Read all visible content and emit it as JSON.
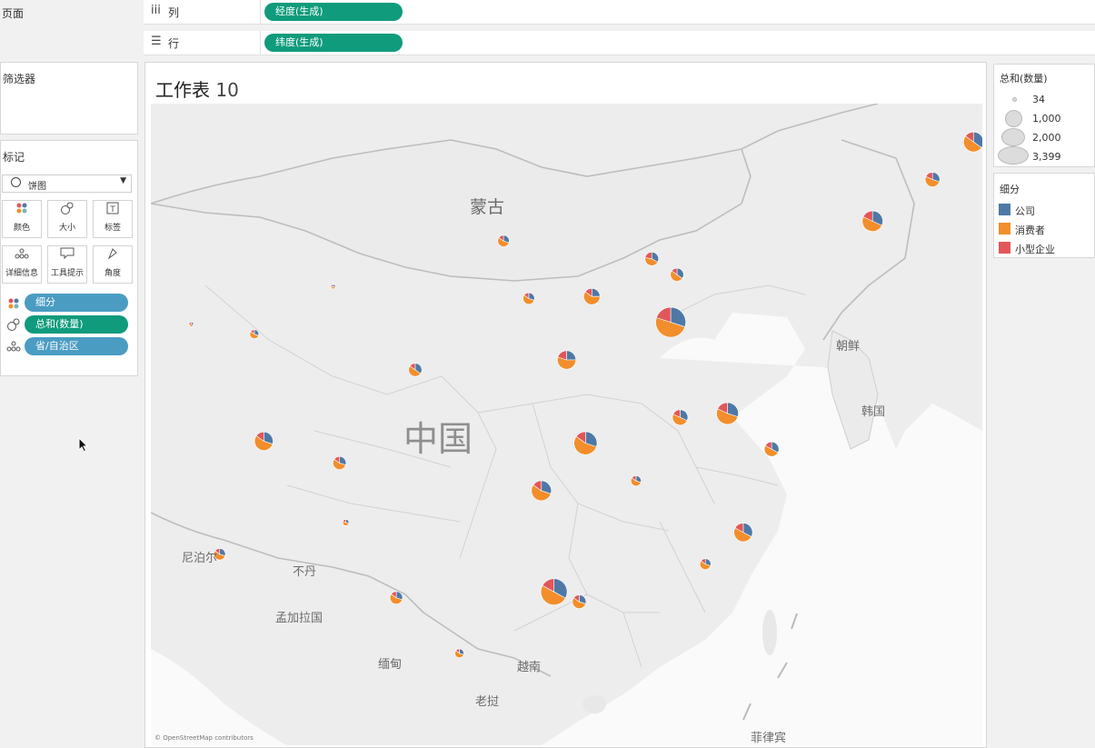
{
  "shelves": {
    "pages_title": "页面",
    "columns": {
      "icon": "iii",
      "label": "列",
      "pill": "经度(生成)"
    },
    "rows": {
      "icon": "☰",
      "label": "行",
      "pill": "纬度(生成)"
    }
  },
  "filters": {
    "title": "筛选器"
  },
  "marks": {
    "title": "标记",
    "type_value": "饼图",
    "buttons": [
      {
        "label": "颜色",
        "icon": "palette-icon"
      },
      {
        "label": "大小",
        "icon": "size-icon"
      },
      {
        "label": "标签",
        "icon": "text-icon"
      },
      {
        "label": "详细信息",
        "icon": "detail-icon"
      },
      {
        "label": "工具提示",
        "icon": "tooltip-icon"
      },
      {
        "label": "角度",
        "icon": "angle-icon"
      }
    ],
    "fields": [
      {
        "label": "细分",
        "color": "#4a9cc3",
        "icon": "color-dots-icon"
      },
      {
        "label": "总和(数量)",
        "color": "#0f9b7c",
        "icon": "size-icon"
      },
      {
        "label": "省/自治区",
        "color": "#4a9cc3",
        "icon": "detail-icon"
      }
    ]
  },
  "sheet": {
    "title": "工作表",
    "title_number": "10",
    "attribution": "© OpenStreetMap contributors",
    "map_labels": [
      "蒙古",
      "中国",
      "朝鲜",
      "韩国",
      "尼泊尔",
      "不丹",
      "孟加拉国",
      "缅甸",
      "越南",
      "老挝",
      "菲律宾"
    ]
  },
  "size_legend": {
    "title": "总和(数量)",
    "items": [
      "34",
      "1,000",
      "2,000",
      "3,399"
    ]
  },
  "color_legend": {
    "title": "细分",
    "items": [
      {
        "label": "公司",
        "color": "#4e79a7"
      },
      {
        "label": "消费者",
        "color": "#f28e2b"
      },
      {
        "label": "小型企业",
        "color": "#e15759"
      }
    ]
  },
  "pies": [
    {
      "lon": 126.6,
      "lat": 45.8,
      "qty": 1500,
      "company": 0.35,
      "consumer": 0.5,
      "small": 0.15
    },
    {
      "lon": 111.7,
      "lat": 40.8,
      "qty": 500,
      "company": 0.3,
      "consumer": 0.55,
      "small": 0.15
    },
    {
      "lon": 125.3,
      "lat": 43.9,
      "qty": 800,
      "company": 0.3,
      "consumer": 0.52,
      "small": 0.18
    },
    {
      "lon": 123.4,
      "lat": 41.8,
      "qty": 1600,
      "company": 0.32,
      "consumer": 0.5,
      "small": 0.18
    },
    {
      "lon": 116.4,
      "lat": 39.9,
      "qty": 700,
      "company": 0.33,
      "consumer": 0.45,
      "small": 0.22
    },
    {
      "lon": 114.5,
      "lat": 38.0,
      "qty": 1000,
      "company": 0.25,
      "consumer": 0.6,
      "small": 0.15
    },
    {
      "lon": 117.2,
      "lat": 39.1,
      "qty": 650,
      "company": 0.35,
      "consumer": 0.5,
      "small": 0.15
    },
    {
      "lon": 112.5,
      "lat": 37.9,
      "qty": 500,
      "company": 0.3,
      "consumer": 0.55,
      "small": 0.15
    },
    {
      "lon": 117.0,
      "lat": 36.7,
      "qty": 3399,
      "company": 0.3,
      "consumer": 0.5,
      "small": 0.2
    },
    {
      "lon": 103.8,
      "lat": 36.1,
      "qty": 300,
      "company": 0.3,
      "consumer": 0.55,
      "small": 0.15
    },
    {
      "lon": 106.3,
      "lat": 38.5,
      "qty": 60,
      "company": 0.3,
      "consumer": 0.4,
      "small": 0.3
    },
    {
      "lon": 101.8,
      "lat": 36.6,
      "qty": 45,
      "company": 0.3,
      "consumer": 0.4,
      "small": 0.3
    },
    {
      "lon": 87.6,
      "lat": 43.8,
      "qty": 45,
      "company": 0.3,
      "consumer": 0.4,
      "small": 0.3
    },
    {
      "lon": 108.9,
      "lat": 34.3,
      "qty": 650,
      "company": 0.35,
      "consumer": 0.5,
      "small": 0.15
    },
    {
      "lon": 113.7,
      "lat": 34.8,
      "qty": 1300,
      "company": 0.25,
      "consumer": 0.55,
      "small": 0.2
    },
    {
      "lon": 118.8,
      "lat": 32.1,
      "qty": 1800,
      "company": 0.3,
      "consumer": 0.52,
      "small": 0.18
    },
    {
      "lon": 117.3,
      "lat": 31.9,
      "qty": 900,
      "company": 0.32,
      "consumer": 0.5,
      "small": 0.18
    },
    {
      "lon": 120.2,
      "lat": 30.3,
      "qty": 800,
      "company": 0.33,
      "consumer": 0.5,
      "small": 0.17
    },
    {
      "lon": 114.3,
      "lat": 30.6,
      "qty": 2000,
      "company": 0.3,
      "consumer": 0.55,
      "small": 0.15
    },
    {
      "lon": 104.1,
      "lat": 30.7,
      "qty": 1300,
      "company": 0.3,
      "consumer": 0.55,
      "small": 0.15
    },
    {
      "lon": 106.5,
      "lat": 29.6,
      "qty": 650,
      "company": 0.3,
      "consumer": 0.55,
      "small": 0.15
    },
    {
      "lon": 112.9,
      "lat": 28.2,
      "qty": 1500,
      "company": 0.3,
      "consumer": 0.55,
      "small": 0.15
    },
    {
      "lon": 115.9,
      "lat": 28.7,
      "qty": 400,
      "company": 0.3,
      "consumer": 0.55,
      "small": 0.15
    },
    {
      "lon": 119.3,
      "lat": 26.1,
      "qty": 1300,
      "company": 0.33,
      "consumer": 0.5,
      "small": 0.17
    },
    {
      "lon": 106.7,
      "lat": 26.6,
      "qty": 150,
      "company": 0.3,
      "consumer": 0.5,
      "small": 0.2
    },
    {
      "lon": 102.7,
      "lat": 25.0,
      "qty": 500,
      "company": 0.3,
      "consumer": 0.55,
      "small": 0.15
    },
    {
      "lon": 108.3,
      "lat": 22.8,
      "qty": 600,
      "company": 0.3,
      "consumer": 0.55,
      "small": 0.15
    },
    {
      "lon": 113.3,
      "lat": 23.1,
      "qty": 2600,
      "company": 0.33,
      "consumer": 0.5,
      "small": 0.17
    },
    {
      "lon": 110.3,
      "lat": 20.0,
      "qty": 300,
      "company": 0.3,
      "consumer": 0.55,
      "small": 0.15
    },
    {
      "lon": 114.1,
      "lat": 22.6,
      "qty": 700,
      "company": 0.3,
      "consumer": 0.55,
      "small": 0.15
    },
    {
      "lon": 118.1,
      "lat": 24.5,
      "qty": 450,
      "company": 0.3,
      "consumer": 0.55,
      "small": 0.15
    },
    {
      "lon": 91.1,
      "lat": 29.6,
      "qty": 34,
      "company": 0.3,
      "consumer": 0.4,
      "small": 0.3
    },
    {
      "lon": 75.9,
      "lat": 39.5,
      "qty": 60,
      "company": 0.3,
      "consumer": 0.4,
      "small": 0.3
    }
  ]
}
